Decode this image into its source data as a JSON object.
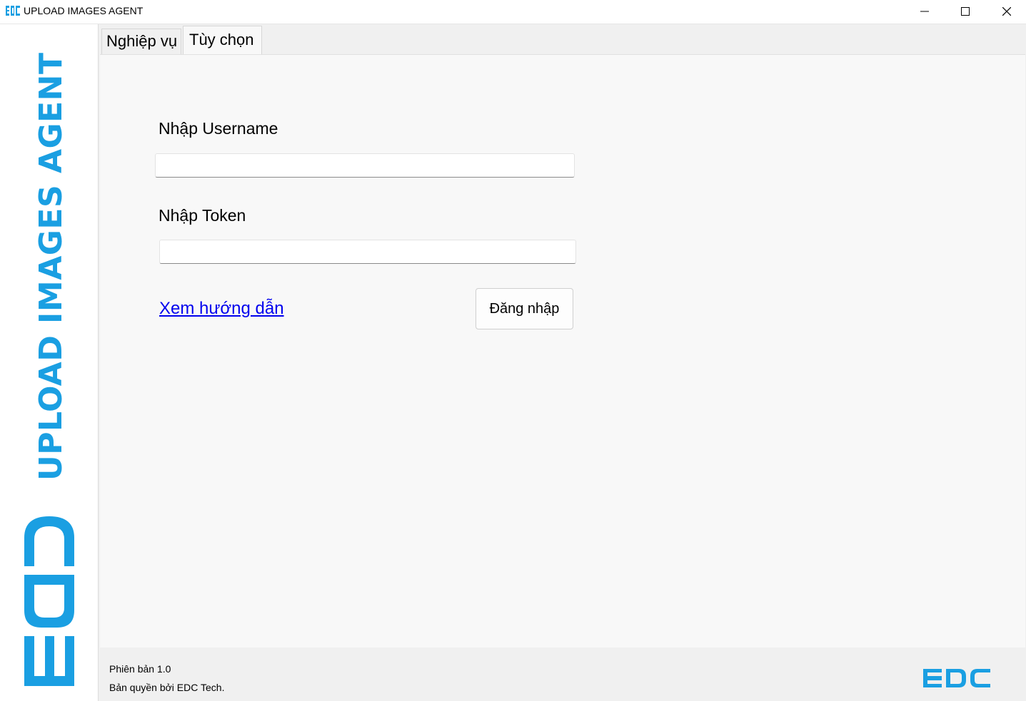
{
  "window": {
    "title": "UPLOAD IMAGES AGENT",
    "icon": "edc-app-icon",
    "controls": [
      "minimize-icon",
      "maximize-icon",
      "close-icon"
    ]
  },
  "sidebar": {
    "vertical_title": "UPLOAD IMAGES AGENT",
    "logo_text": "EDC",
    "brand_color": "#1a9fe2"
  },
  "tabs": [
    {
      "label": "Nghiệp vụ",
      "selected": false
    },
    {
      "label": "Tùy chọn",
      "selected": true
    }
  ],
  "form": {
    "username_label": "Nhập Username",
    "username_value": "",
    "token_label": "Nhập Token",
    "token_value": "",
    "guide_link": "Xem hướng dẫn",
    "login_button": "Đăng nhập"
  },
  "footer": {
    "version": "Phiên bản 1.0",
    "copyright": "Bản quyền bởi EDC Tech.",
    "logo_text": "EDC"
  }
}
